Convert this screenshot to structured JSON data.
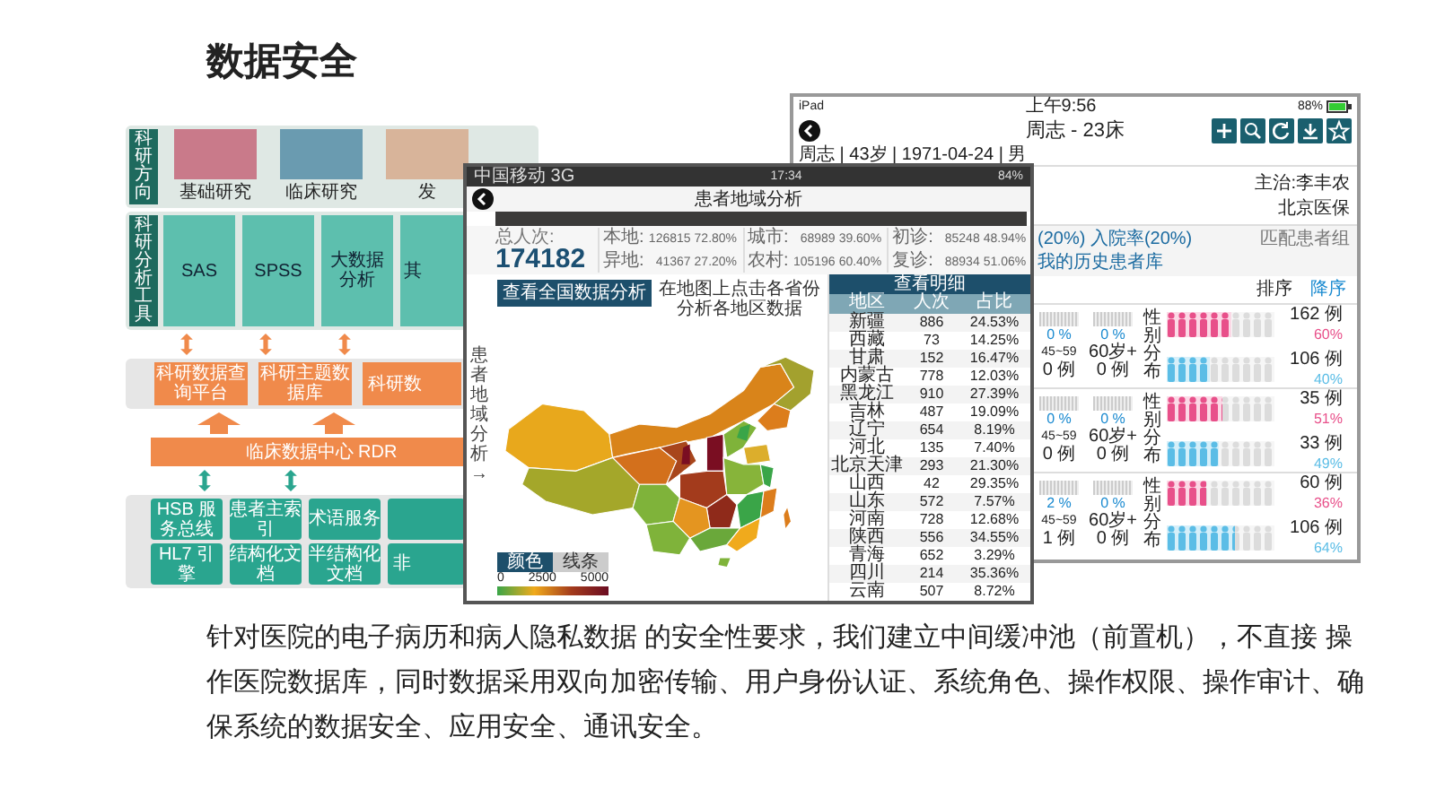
{
  "title": "数据安全",
  "diagram": {
    "research_label": "科研方向",
    "research_areas": [
      "基础研究",
      "临床研究",
      "发"
    ],
    "tools_label": "科研分析工具",
    "tools": [
      "SAS",
      "SPSS",
      "大数据分析",
      "其"
    ],
    "platforms": [
      "科研数据查询平台",
      "科研主题数据库",
      "科研数"
    ],
    "data_center": "临床数据中心 RDR",
    "services": [
      [
        "HSB 服务总线",
        "患者主索引",
        "术语服务"
      ],
      [
        "HL7 引擎",
        "结构化文档",
        "半结构化文档",
        "非"
      ]
    ]
  },
  "tablet": {
    "status": {
      "device": "iPad",
      "time": "上午9:56",
      "battery": "88%"
    },
    "title": "周志 - 23床",
    "patient_info": "周志 | 43岁 | 1971-04-24 | 男",
    "doctor": "主治:李丰农",
    "insurance": "北京医保",
    "tabs": [
      "(20%) 入院率(20%)",
      "匹配患者组",
      "我的历史患者库"
    ],
    "sort_label": "排序",
    "sort_order": "降序",
    "rows": [
      {
        "ages": [
          {
            "percent": "0 %",
            "range": "45~59",
            "count": "0 例"
          },
          {
            "percent": "0 %",
            "range": "60岁+",
            "count": "0 例"
          }
        ],
        "gender_label": "性别分布",
        "genders": [
          {
            "kind": "female",
            "count": "162 例",
            "percent": "60%",
            "level": 0.6
          },
          {
            "kind": "male",
            "count": "106 例",
            "percent": "40%",
            "level": 0.4
          }
        ]
      },
      {
        "ages": [
          {
            "percent": "0 %",
            "range": "45~59",
            "count": "0 例"
          },
          {
            "percent": "0 %",
            "range": "60岁+",
            "count": "0 例"
          }
        ],
        "gender_label": "性别分布",
        "genders": [
          {
            "kind": "female",
            "count": "35 例",
            "percent": "51%",
            "level": 0.51
          },
          {
            "kind": "male",
            "count": "33 例",
            "percent": "49%",
            "level": 0.49
          }
        ]
      },
      {
        "ages": [
          {
            "percent": "2 %",
            "range": "45~59",
            "count": "1 例"
          },
          {
            "percent": "0 %",
            "range": "60岁+",
            "count": "0 例"
          }
        ],
        "gender_label": "性别分布",
        "genders": [
          {
            "kind": "female",
            "count": "60 例",
            "percent": "36%",
            "level": 0.36
          },
          {
            "kind": "male",
            "count": "106 例",
            "percent": "64%",
            "level": 0.64
          }
        ]
      }
    ]
  },
  "map_app": {
    "status": {
      "carrier": "中国移动 3G",
      "time": "17:34",
      "battery": "84%"
    },
    "title": "患者地域分析",
    "total_label": "总人次:",
    "total": "174182",
    "stats": [
      [
        {
          "label": "本地:",
          "value": "126815",
          "percent": "72.80%"
        },
        {
          "label": "异地:",
          "value": "41367",
          "percent": "27.20%"
        }
      ],
      [
        {
          "label": "城市:",
          "value": "68989",
          "percent": "39.60%"
        },
        {
          "label": "农村:",
          "value": "105196",
          "percent": "60.40%"
        }
      ],
      [
        {
          "label": "初诊:",
          "value": "85248",
          "percent": "48.94%"
        },
        {
          "label": "复诊:",
          "value": "88934",
          "percent": "51.06%"
        }
      ]
    ],
    "side_label": "患者地域分析→",
    "national_button": "查看全国数据分析",
    "hint": "在地图上点击各省份分析各地区数据",
    "legend_tabs": [
      {
        "label": "颜色",
        "selected": true
      },
      {
        "label": "线条",
        "selected": false
      }
    ],
    "legend_ticks": [
      "0",
      "2500",
      "5000"
    ],
    "table_title": "查看明细",
    "columns": [
      "地区",
      "人次",
      "占比"
    ],
    "rows": [
      [
        "新疆",
        "886",
        "24.53%"
      ],
      [
        "西藏",
        "73",
        "14.25%"
      ],
      [
        "甘肃",
        "152",
        "16.47%"
      ],
      [
        "内蒙古",
        "778",
        "12.03%"
      ],
      [
        "黑龙江",
        "910",
        "27.39%"
      ],
      [
        "吉林",
        "487",
        "19.09%"
      ],
      [
        "辽宁",
        "654",
        "8.19%"
      ],
      [
        "河北",
        "135",
        "7.40%"
      ],
      [
        "北京天津",
        "293",
        "21.30%"
      ],
      [
        "山西",
        "42",
        "29.35%"
      ],
      [
        "山东",
        "572",
        "7.57%"
      ],
      [
        "河南",
        "728",
        "12.68%"
      ],
      [
        "陕西",
        "556",
        "34.55%"
      ],
      [
        "青海",
        "652",
        "3.29%"
      ],
      [
        "四川",
        "214",
        "35.36%"
      ],
      [
        "云南",
        "507",
        "8.72%"
      ]
    ]
  },
  "description": "针对医院的电子病历和病人隐私数据 的安全性要求，我们建立中间缓冲池（前置机），不直接 操作医院数据库，同时数据采用双向加密传输、用户身份认证、系统角色、操作权限、操作审计、确保系统的数据安全、应用安全、通讯安全。"
}
